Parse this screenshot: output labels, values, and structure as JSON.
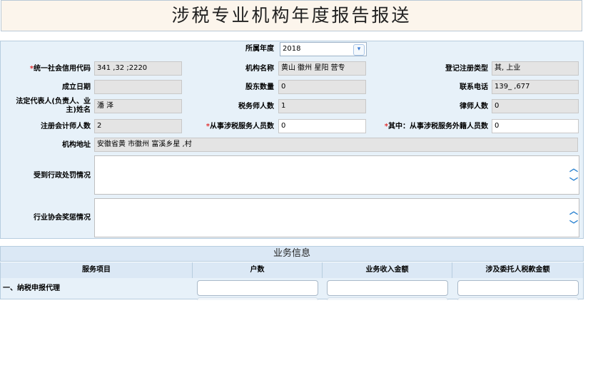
{
  "page": {
    "title": "涉税专业机构年度报告报送"
  },
  "form": {
    "year": {
      "label": "所属年度",
      "value": "2018"
    },
    "credit_code": {
      "required_mark": "*",
      "label": "统一社会信用代码",
      "value": "341   ,32    ;2220"
    },
    "org_name": {
      "label": "机构名称",
      "value": "黄山   徽州   星阳   营专"
    },
    "reg_type": {
      "label": "登记注册类型",
      "value": "其, 上业"
    },
    "founded": {
      "label": "成立日期",
      "value": ""
    },
    "shareholders": {
      "label": "股东数量",
      "value": "0"
    },
    "phone": {
      "label": "联系电话",
      "value": "139_  ,677"
    },
    "legal_rep": {
      "label_line1": "法定代表人(负责人、业",
      "label_line2": "主)姓名",
      "value": "潘   泽"
    },
    "tax_agents": {
      "label": "税务师人数",
      "value": "1"
    },
    "lawyers": {
      "label": "律师人数",
      "value": "0"
    },
    "cpa": {
      "label": "注册会计师人数",
      "value": "2"
    },
    "tax_staff": {
      "required_mark": "*",
      "label": "从事涉税服务人员数",
      "value": "0"
    },
    "outsourced": {
      "required_mark": "*",
      "label": "其中：从事涉税服务外籍人员数",
      "value": "0"
    },
    "address": {
      "label": "机构地址",
      "value": "安徽省黄   市徽州   富溪乡星   ,村"
    },
    "penalty": {
      "label": "受到行政处罚情况"
    },
    "awards": {
      "label": "行业协会奖惩情况"
    }
  },
  "business": {
    "header": "业务信息",
    "columns": [
      "服务项目",
      "户数",
      "业务收入金额",
      "涉及委托人税款金额"
    ],
    "rows": [
      {
        "item": "一、纳税申报代理"
      }
    ]
  },
  "icons": {
    "scroll_up": "chevron-up-icon",
    "scroll_down": "chevron-down-icon",
    "dropdown": "chevron-down-icon"
  },
  "colors": {
    "accent": "#2a82d0",
    "required": "#e03030",
    "panel_bg": "#e7f1f9",
    "header_bg": "#dbe8f5",
    "title_bg": "#fcf5ec"
  }
}
